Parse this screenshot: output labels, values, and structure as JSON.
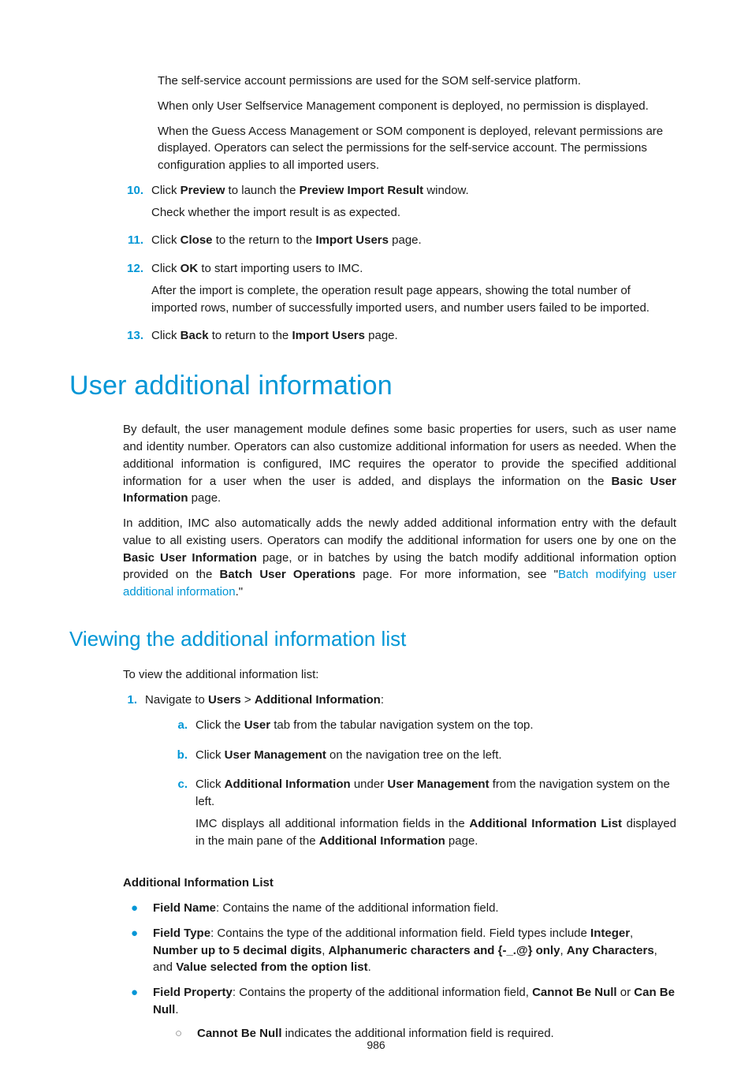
{
  "intro": {
    "p1": "The self-service account permissions are used for the SOM self-service platform.",
    "p2": "When only User Selfservice Management component is deployed, no permission is displayed.",
    "p3": "When the Guess Access Management or SOM component is deployed, relevant permissions are displayed. Operators can select the permissions for the self-service account. The permissions configuration applies to all imported users."
  },
  "steps": {
    "s10": {
      "num": "10.",
      "t1": "Click ",
      "b1": "Preview",
      "t2": " to launch the ",
      "b2": "Preview Import Result",
      "t3": " window.",
      "p2": "Check whether the import result is as expected."
    },
    "s11": {
      "num": "11.",
      "t1": "Click ",
      "b1": "Close",
      "t2": " to the return to the ",
      "b2": "Import Users",
      "t3": " page."
    },
    "s12": {
      "num": "12.",
      "t1": "Click ",
      "b1": "OK",
      "t2": " to start importing users to IMC.",
      "p2": "After the import is complete, the operation result page appears, showing the total number of imported rows, number of successfully imported users, and number users failed to be imported."
    },
    "s13": {
      "num": "13.",
      "t1": "Click ",
      "b1": "Back",
      "t2": " to return to the ",
      "b2": "Import Users",
      "t3": " page."
    }
  },
  "h1": "User additional information",
  "section1": {
    "p1a": "By default, the user management module defines some basic properties for users, such as user name and identity number. Operators can also customize additional information for users as needed. When the additional information is configured, IMC requires the operator to provide the specified additional information for a user when the user is added, and displays the information on the ",
    "p1b": "Basic User Information",
    "p1c": " page.",
    "p2a": "In addition, IMC also automatically adds the newly added additional information entry with the default value to all existing users. Operators can modify the additional information for users one by one on the ",
    "p2b": "Basic User Information",
    "p2c": " page, or in batches by using the batch modify additional information option provided on the ",
    "p2d": "Batch User Operations",
    "p2e": " page. For more information, see \"",
    "link": "Batch modifying user additional information",
    "p2f": ".\""
  },
  "h2": "Viewing the additional information list",
  "section2": {
    "lead": "To view the additional information list:",
    "step1": {
      "num": "1.",
      "t1": "Navigate to ",
      "b1": "Users",
      "t2": " > ",
      "b2": "Additional Information",
      "t3": ":",
      "a": {
        "num": "a.",
        "t1": "Click the ",
        "b1": "User",
        "t2": " tab from the tabular navigation system on the top."
      },
      "b": {
        "num": "b.",
        "t1": "Click ",
        "b1": "User Management",
        "t2": " on the navigation tree on the left."
      },
      "c": {
        "num": "c.",
        "t1": "Click ",
        "b1": "Additional Information",
        "t2": " under ",
        "b2": "User Management",
        "t3": " from the navigation system on the left.",
        "p2a": "IMC displays all additional information fields in the ",
        "p2b": "Additional Information List",
        "p2c": " displayed in the main pane of the ",
        "p2d": "Additional Information",
        "p2e": " page."
      }
    }
  },
  "listHeading": "Additional Information List",
  "bullets": {
    "b1": {
      "label": "Field Name",
      "text": ": Contains the name of the additional information field."
    },
    "b2": {
      "label": "Field Type",
      "t1": ": Contains the type of the additional information field. Field types include ",
      "o1": "Integer",
      "c1": ", ",
      "o2": "Number up to 5 decimal digits",
      "c2": ", ",
      "o3": "Alphanumeric characters and {-_.@} only",
      "c3": ", ",
      "o4": "Any Characters",
      "c4": ", and ",
      "o5": "Value selected from the option list",
      "end": "."
    },
    "b3": {
      "label": "Field Property",
      "t1": ": Contains the property of the additional information field, ",
      "o1": "Cannot Be Null",
      "t2": " or ",
      "o2": "Can Be Null",
      "end": "."
    },
    "sub1": {
      "b": "Cannot Be Null",
      "t": " indicates the additional information field is required."
    }
  },
  "pageNumber": "986"
}
